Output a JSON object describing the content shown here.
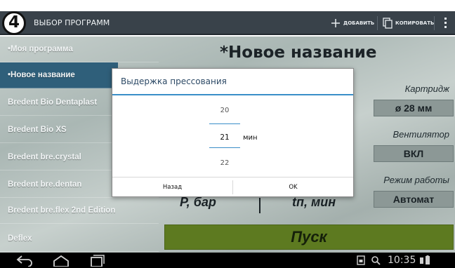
{
  "step_badge": "4",
  "action_bar": {
    "title": "ВЫБОР ПРОГРАММ",
    "add_label": "ДОБАВИТЬ",
    "copy_label": "КОПИРОВАТЬ",
    "menu_icon": "overflow-menu-icon"
  },
  "program_list": [
    {
      "label": "•Моя программа",
      "selected": false
    },
    {
      "label": "•Новое название",
      "selected": true
    },
    {
      "label": "Bredent Bio Dentaplast",
      "selected": false
    },
    {
      "label": "Bredent Bio XS",
      "selected": false
    },
    {
      "label": "Bredent bre.crystal",
      "selected": false
    },
    {
      "label": "Bredent bre.dentan",
      "selected": false
    },
    {
      "label": "Bredent bre.flex 2nd Edition",
      "selected": false
    },
    {
      "label": "Deflex",
      "selected": false
    }
  ],
  "program_title": "*Новое название",
  "settings": {
    "cartridge_label": "Картридж",
    "cartridge_value": "ø 28 мм",
    "fan_label": "Вентилятор",
    "fan_value": "ВКЛ",
    "mode_label": "Режим работы",
    "mode_value": "Автомат"
  },
  "columns": {
    "pressure": "P, бар",
    "time": "tп, мин"
  },
  "start_label": "Пуск",
  "dialog": {
    "title": "Выдержка прессования",
    "prev_value": "20",
    "current_value": "21",
    "next_value": "22",
    "unit": "мин",
    "back_label": "Назад",
    "ok_label": "OK"
  },
  "status_bar": {
    "time": "10:35"
  },
  "colors": {
    "action_bar": "#39424a",
    "selected_item": "#2f5f7a",
    "start_button": "#5d7a20",
    "accent": "#3a8ec8"
  }
}
